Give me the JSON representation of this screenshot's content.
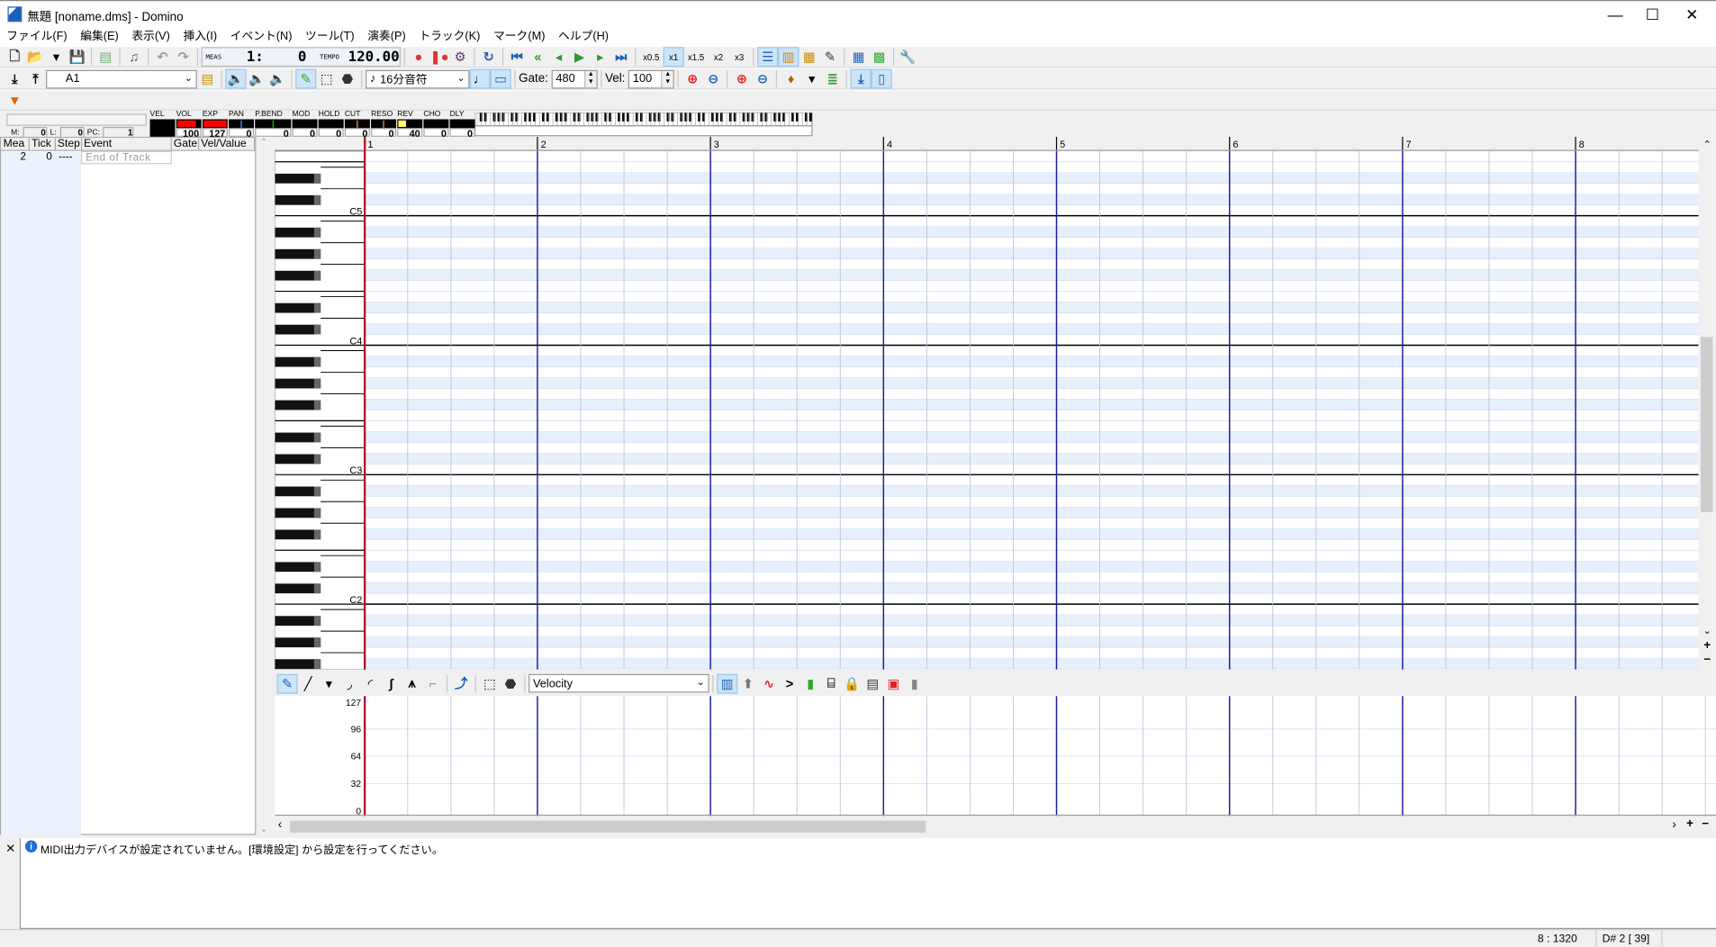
{
  "window": {
    "title": "無題 [noname.dms] - Domino",
    "controls": [
      "—",
      "☐",
      "✕"
    ]
  },
  "menu": [
    "ファイル(F)",
    "編集(E)",
    "表示(V)",
    "挿入(I)",
    "イベント(N)",
    "ツール(T)",
    "演奏(P)",
    "トラック(K)",
    "マーク(M)",
    "ヘルプ(H)"
  ],
  "toolbar1": {
    "file": [
      {
        "n": "new-file",
        "g": "🗋",
        "c": "#333"
      },
      {
        "n": "open-folder",
        "g": "📂",
        "c": "#d9a400"
      },
      {
        "n": "open-dropdown",
        "g": "▾",
        "c": "#000"
      },
      {
        "n": "save",
        "g": "💾",
        "c": "#1a3fa6"
      }
    ],
    "tools": [
      {
        "n": "properties",
        "g": "▤",
        "c": "#6a6"
      },
      {
        "n": "sound-test",
        "g": "♫",
        "c": "#555"
      },
      {
        "n": "undo",
        "g": "↶",
        "c": "#999"
      },
      {
        "n": "redo",
        "g": "↷",
        "c": "#999"
      }
    ],
    "meas_label": "MEAS",
    "meas_value": "1:    0",
    "tempo_label": "TEMPO",
    "tempo_value": "120.00",
    "transport": [
      {
        "n": "record",
        "g": "●",
        "c": "#d33"
      },
      {
        "n": "record-pause",
        "g": "❚●",
        "c": "#d33"
      },
      {
        "n": "mixdown",
        "g": "⚙",
        "c": "#637"
      },
      {
        "n": "loop",
        "g": "↻",
        "c": "#1d5fb8"
      },
      {
        "n": "go-start",
        "g": "⏮",
        "c": "#1d5fb8"
      },
      {
        "n": "rewind",
        "g": "«",
        "c": "#393"
      },
      {
        "n": "back",
        "g": "◂",
        "c": "#393"
      },
      {
        "n": "play",
        "g": "▶",
        "c": "#393"
      },
      {
        "n": "forward",
        "g": "▸",
        "c": "#393"
      },
      {
        "n": "go-end",
        "g": "⏭",
        "c": "#1d5fb8"
      }
    ],
    "speeds": [
      "x0.5",
      "x1",
      "x1.5",
      "x2",
      "x3"
    ],
    "speed_selected": "x1",
    "views": [
      {
        "n": "event-list-view",
        "g": "☰",
        "c": "#1d5fb8",
        "on": true
      },
      {
        "n": "piano-roll-view",
        "g": "▥",
        "c": "#c80",
        "on": true
      },
      {
        "n": "track-view",
        "g": "▦",
        "c": "#c80"
      },
      {
        "n": "comment-view",
        "g": "✎",
        "c": "#333"
      },
      {
        "n": "tempo-grid",
        "g": "▦",
        "c": "#1d5fb8"
      },
      {
        "n": "level-meter",
        "g": "▩",
        "c": "#3a3"
      },
      {
        "n": "settings-wrench",
        "g": "🔧",
        "c": "#c33"
      }
    ]
  },
  "toolbar2": {
    "track_sel": "A1",
    "pre": [
      {
        "n": "track-down",
        "g": "⤓",
        "c": "#000"
      },
      {
        "n": "track-up",
        "g": "⤒",
        "c": "#000"
      }
    ],
    "mid": [
      {
        "n": "track-settings",
        "g": "▤",
        "c": "#c80"
      },
      {
        "n": "solo",
        "g": "🔈",
        "c": "#c80",
        "on": true
      },
      {
        "n": "mute-s",
        "g": "🔈",
        "c": "#c80"
      },
      {
        "n": "mute-a",
        "g": "🔈",
        "c": "#c80"
      },
      {
        "n": "pencil-tool",
        "g": "✎",
        "c": "#3a3",
        "on": true
      },
      {
        "n": "select-tool",
        "g": "⬚",
        "c": "#000"
      },
      {
        "n": "eraser-tool",
        "g": "⬣",
        "c": "#333"
      }
    ],
    "note_len": "16分音符",
    "gate_label": "Gate:",
    "gate": "480",
    "vel_label": "Vel:",
    "vel": "100",
    "post": [
      {
        "n": "zoom-in-h",
        "g": "⊕",
        "c": "#d22"
      },
      {
        "n": "zoom-out-h",
        "g": "⊖",
        "c": "#1d5fb8"
      },
      {
        "n": "zoom-in-v",
        "g": "⊕",
        "c": "#d22"
      },
      {
        "n": "zoom-out-v",
        "g": "⊖",
        "c": "#1d5fb8"
      },
      {
        "n": "pitch-bell",
        "g": "♦",
        "c": "#a60"
      },
      {
        "n": "bell-dropdown",
        "g": "▾",
        "c": "#000"
      },
      {
        "n": "channel-colors",
        "g": "≣",
        "c": "#393"
      },
      {
        "n": "follow-playback",
        "g": "⤓",
        "c": "#1d5fb8",
        "on": true
      },
      {
        "n": "book-view",
        "g": "▯",
        "c": "#1d5fb8",
        "on": true
      }
    ]
  },
  "toolbar3": {
    "marker_icon": "marker-add-icon"
  },
  "mixer": {
    "m_label": "M:",
    "m": "0",
    "l_label": "L:",
    "l": "0",
    "pc_label": "PC:",
    "pc": "1",
    "channels": [
      {
        "label": "VEL",
        "value": ""
      },
      {
        "label": "VOL",
        "value": "100",
        "fill": 0.79,
        "color": "#ff0000"
      },
      {
        "label": "EXP",
        "value": "127",
        "fill": 1,
        "color": "#ff0000"
      },
      {
        "label": "PAN",
        "value": "0",
        "mark": 0.5,
        "color": "#4aa3ff"
      },
      {
        "label": "P.BEND",
        "value": "0",
        "mark": 0.5,
        "color": "#00d000"
      },
      {
        "label": "MOD",
        "value": "0"
      },
      {
        "label": "HOLD",
        "value": "0"
      },
      {
        "label": "CUT",
        "value": "0",
        "mark": 0.5,
        "color": "#ff9933"
      },
      {
        "label": "RESO",
        "value": "0",
        "mark": 0.5,
        "color": "#ff9933"
      },
      {
        "label": "REV",
        "value": "40",
        "fill": 0.31,
        "color": "#ffff66"
      },
      {
        "label": "CHO",
        "value": "0"
      },
      {
        "label": "DLY",
        "value": "0"
      }
    ]
  },
  "eventlist": {
    "headers": [
      "Mea",
      "Tick",
      "Step",
      "Event",
      "Gate",
      "Vel/Value"
    ],
    "rows": [
      {
        "mea": "2",
        "tick": "0",
        "step": "----",
        "event": "End of Track",
        "gate": "",
        "vel": ""
      }
    ]
  },
  "pianoroll": {
    "measures": [
      "1",
      "2",
      "3",
      "4",
      "5",
      "6",
      "7",
      "8"
    ],
    "octave_labels": [
      "C5",
      "C4",
      "C3",
      "C2"
    ],
    "playhead_color": "#e00000",
    "measure_line_color": "#1a1aa0"
  },
  "control": {
    "tools": [
      {
        "n": "pen-tool",
        "g": "✎",
        "c": "#1d5fb8",
        "on": true
      },
      {
        "n": "line-tool",
        "g": "╱",
        "c": "#000"
      },
      {
        "n": "line-dropdown",
        "g": "▾",
        "c": "#000"
      },
      {
        "n": "curve1",
        "g": "◞",
        "c": "#000"
      },
      {
        "n": "curve2",
        "g": "◜",
        "c": "#000"
      },
      {
        "n": "s-curve",
        "g": "∫",
        "c": "#000"
      },
      {
        "n": "random",
        "g": "⩚",
        "c": "#000"
      },
      {
        "n": "step-tool",
        "g": "⌐",
        "c": "#999"
      },
      {
        "n": "transform-tool",
        "g": "⤴",
        "c": "#1d5fb8"
      },
      {
        "n": "ctl-select",
        "g": "⬚",
        "c": "#000"
      },
      {
        "n": "ctl-eraser",
        "g": "⬣",
        "c": "#333"
      }
    ],
    "selected": "Velocity",
    "tools2": [
      {
        "n": "bar-mode",
        "g": "▥",
        "c": "#1d5fb8",
        "on": true
      },
      {
        "n": "stamp",
        "g": "⬆",
        "c": "#777"
      },
      {
        "n": "lfo",
        "g": "∿",
        "c": "#d22"
      },
      {
        "n": "compare",
        "g": ">",
        "c": "#000"
      },
      {
        "n": "level",
        "g": "▮",
        "c": "#3a3"
      },
      {
        "n": "ctl-settings",
        "g": "⌸",
        "c": "#333"
      },
      {
        "n": "lock",
        "g": "🔒",
        "c": "#c80"
      },
      {
        "n": "ctl-list",
        "g": "▤",
        "c": "#333"
      },
      {
        "n": "ctl-display",
        "g": "▣",
        "c": "#d22"
      },
      {
        "n": "ctl-gray",
        "g": "▮",
        "c": "#888"
      }
    ],
    "yaxis": [
      "127",
      "96",
      "64",
      "32",
      "0"
    ]
  },
  "message": {
    "text": "MIDI出力デバイスが設定されていません。[環境設定] から設定を行ってください。"
  },
  "status": {
    "position": "8 : 1320",
    "note": "D# 2 [ 39]"
  }
}
